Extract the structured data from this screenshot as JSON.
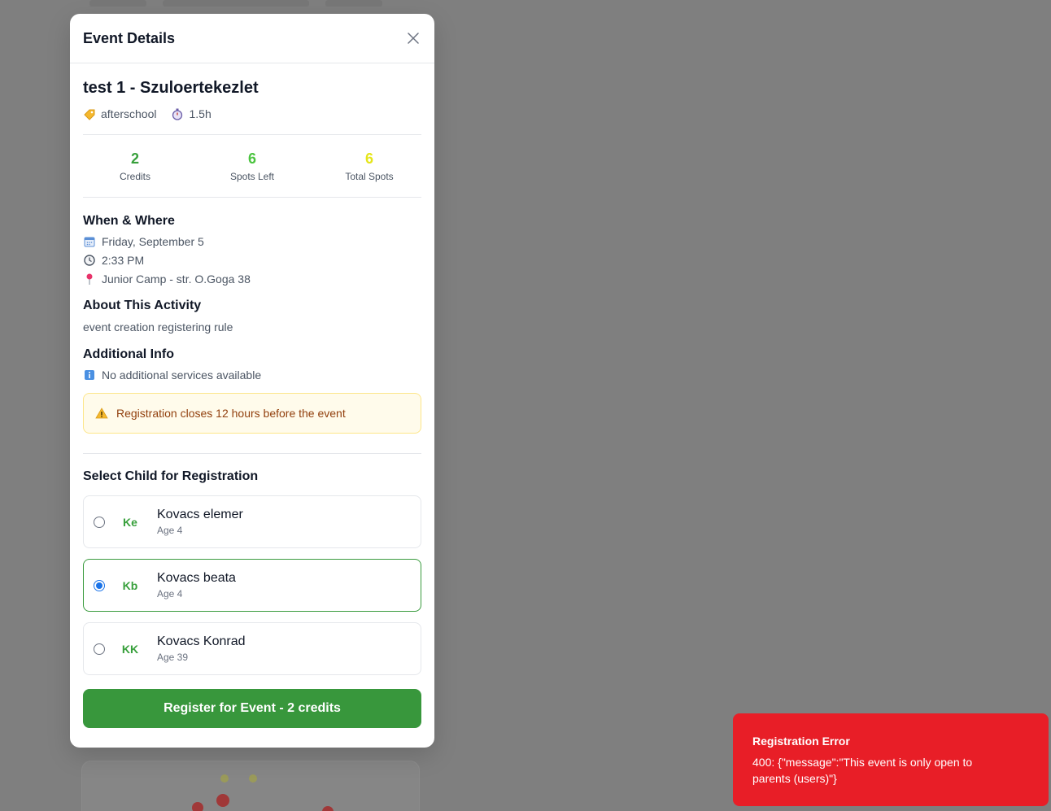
{
  "modal": {
    "title": "Event Details",
    "close_icon": "close-icon"
  },
  "event": {
    "title": "test 1 - Szuloertekezlet",
    "category_icon": "tag-icon",
    "category": "afterschool",
    "duration_icon": "stopwatch-icon",
    "duration": "1.5h"
  },
  "stats": [
    {
      "value": "2",
      "label": "Credits",
      "color": "#38a03c"
    },
    {
      "value": "6",
      "label": "Spots Left",
      "color": "#4bc43f"
    },
    {
      "value": "6",
      "label": "Total Spots",
      "color": "#e5e51a"
    }
  ],
  "when_where": {
    "title": "When & Where",
    "date_icon": "calendar-icon",
    "date": "Friday, September 5",
    "time_icon": "clock-icon",
    "time": "2:33 PM",
    "location_icon": "pin-icon",
    "location": "Junior Camp - str. O.Goga 38"
  },
  "about": {
    "title": "About This Activity",
    "text": "event creation registering rule"
  },
  "additional": {
    "title": "Additional Info",
    "icon": "info-icon",
    "text": "No additional services available"
  },
  "warning": {
    "icon": "warning-icon",
    "text": "Registration closes 12 hours before the event"
  },
  "children_section": {
    "title": "Select Child for Registration",
    "children": [
      {
        "initials": "Ke",
        "name": "Kovacs elemer",
        "age": "Age 4",
        "selected": false
      },
      {
        "initials": "Kb",
        "name": "Kovacs beata",
        "age": "Age 4",
        "selected": true
      },
      {
        "initials": "KK",
        "name": "Kovacs Konrad",
        "age": "Age 39",
        "selected": false
      }
    ]
  },
  "register_button": "Register for Event - 2 credits",
  "toast": {
    "title": "Registration Error",
    "message": "400: {\"message\":\"This event is only open to parents (users)\"}",
    "color": "#e81e27"
  }
}
